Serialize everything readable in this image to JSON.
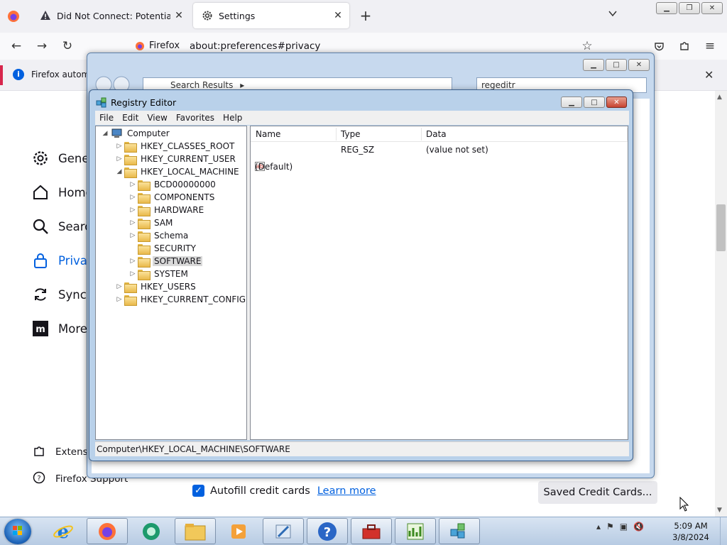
{
  "browser": {
    "tabs": [
      {
        "label": "Did Not Connect: Potential Sec",
        "icon": "warning-icon",
        "active": false
      },
      {
        "label": "Settings",
        "icon": "gear-icon",
        "active": true
      }
    ],
    "identity_label": "Firefox",
    "url": "about:preferences#privacy",
    "notice_text": "Firefox automa"
  },
  "settings": {
    "sidebar": [
      {
        "label": "Gener",
        "icon": "gear-icon"
      },
      {
        "label": "Home",
        "icon": "home-icon"
      },
      {
        "label": "Search",
        "icon": "search-icon"
      },
      {
        "label": "Privac",
        "icon": "lock-icon",
        "selected": true
      },
      {
        "label": "Sync",
        "icon": "sync-icon"
      },
      {
        "label": "More",
        "icon": "mozilla-icon"
      }
    ],
    "footer": [
      {
        "label": "Extensio",
        "icon": "puzzle-icon"
      },
      {
        "label": "Firefox Support",
        "icon": "help-icon"
      }
    ],
    "autofill_label": "Autofill credit cards",
    "learn_more": "Learn more",
    "saved_cards_button": "Saved Credit Cards..."
  },
  "explorer": {
    "address": "Search Results",
    "search_value": "regeditr"
  },
  "regedit": {
    "title": "Registry Editor",
    "menu": [
      "File",
      "Edit",
      "View",
      "Favorites",
      "Help"
    ],
    "tree": [
      {
        "label": "Computer",
        "level": 0,
        "expander": "open"
      },
      {
        "label": "HKEY_CLASSES_ROOT",
        "level": 1,
        "expander": "closed"
      },
      {
        "label": "HKEY_CURRENT_USER",
        "level": 1,
        "expander": "closed"
      },
      {
        "label": "HKEY_LOCAL_MACHINE",
        "level": 1,
        "expander": "open"
      },
      {
        "label": "BCD00000000",
        "level": 2,
        "expander": "closed"
      },
      {
        "label": "COMPONENTS",
        "level": 2,
        "expander": "closed"
      },
      {
        "label": "HARDWARE",
        "level": 2,
        "expander": "closed"
      },
      {
        "label": "SAM",
        "level": 2,
        "expander": "closed"
      },
      {
        "label": "Schema",
        "level": 2,
        "expander": "closed"
      },
      {
        "label": "SECURITY",
        "level": 2,
        "expander": "none"
      },
      {
        "label": "SOFTWARE",
        "level": 2,
        "expander": "closed",
        "selected": true
      },
      {
        "label": "SYSTEM",
        "level": 2,
        "expander": "closed"
      },
      {
        "label": "HKEY_USERS",
        "level": 1,
        "expander": "closed"
      },
      {
        "label": "HKEY_CURRENT_CONFIG",
        "level": 1,
        "expander": "closed"
      }
    ],
    "columns": {
      "name": "Name",
      "type": "Type",
      "data": "Data"
    },
    "values": [
      {
        "name": "(Default)",
        "type": "REG_SZ",
        "data": "(value not set)",
        "icon": "ab"
      }
    ],
    "status_path": "Computer\\HKEY_LOCAL_MACHINE\\SOFTWARE"
  },
  "taskbar": {
    "apps": [
      "internet-explorer-icon",
      "firefox-icon",
      "media-center-icon",
      "file-explorer-icon",
      "media-player-icon",
      "paint-tool-icon",
      "help-icon",
      "toolbox-icon",
      "chart-editor-icon",
      "regedit-icon"
    ],
    "clock_time": "5:09 AM",
    "clock_date": "3/8/2024"
  }
}
